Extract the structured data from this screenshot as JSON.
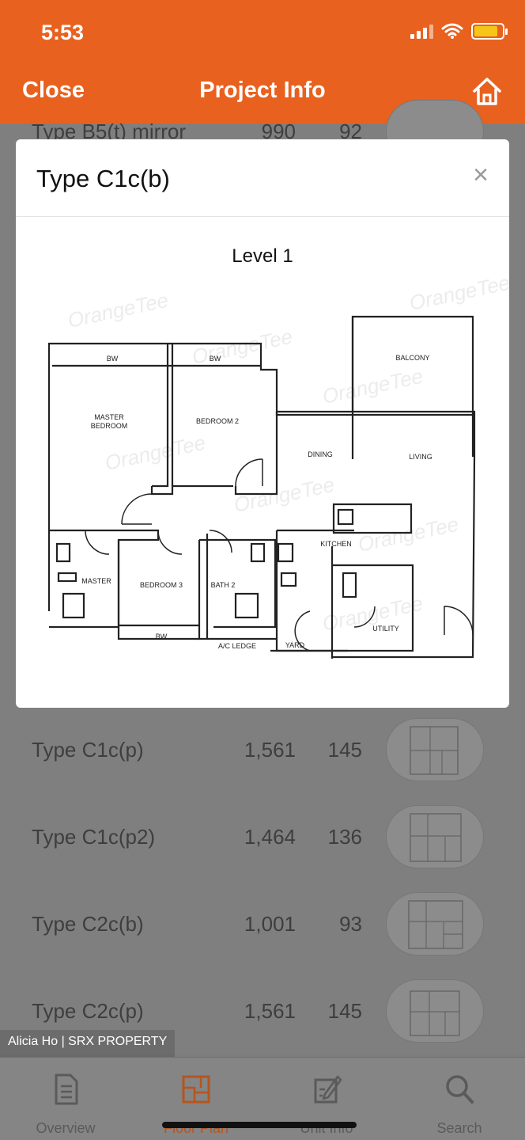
{
  "status": {
    "time": "5:53"
  },
  "nav": {
    "close_label": "Close",
    "title": "Project Info",
    "home_icon": "home-icon"
  },
  "list": {
    "rows": [
      {
        "name": "Type B5(t) mirror",
        "sqft": "990",
        "sqm": "92"
      },
      {
        "name": "Type C1c(p)",
        "sqft": "1,561",
        "sqm": "145"
      },
      {
        "name": "Type C1c(p2)",
        "sqft": "1,464",
        "sqm": "136"
      },
      {
        "name": "Type C2c(b)",
        "sqft": "1,001",
        "sqm": "93"
      },
      {
        "name": "Type C2c(p)",
        "sqft": "1,561",
        "sqm": "145"
      }
    ]
  },
  "modal": {
    "title": "Type C1c(b)",
    "close_symbol": "×",
    "level": "Level 1",
    "plan_labels": {
      "bw1": "BW",
      "bw2": "BW",
      "bw3": "BW",
      "balcony": "BALCONY",
      "master_bedroom_1": "MASTER",
      "master_bedroom_2": "BEDROOM",
      "bedroom2": "BEDROOM 2",
      "dining": "DINING",
      "living": "LIVING",
      "kitchen": "KITCHEN",
      "ac_ledge": "A/C LEDGE",
      "yard": "YARD",
      "utility": "UTILITY",
      "master_bath": "MASTER",
      "bedroom3": "BEDROOM 3",
      "bath2": "BATH 2"
    },
    "watermark_text": "OrangeTee"
  },
  "watermark": {
    "text": "Alicia Ho | SRX PROPERTY"
  },
  "tabs": [
    {
      "label": "Overview",
      "icon": "document-icon"
    },
    {
      "label": "Floor Plan",
      "icon": "floor-plan-icon"
    },
    {
      "label": "Unit Info",
      "icon": "edit-icon"
    },
    {
      "label": "Search",
      "icon": "search-icon"
    }
  ],
  "colors": {
    "brand": "#e8611f",
    "overlay": "#7f7f7f",
    "active_tab": "#b55520"
  }
}
